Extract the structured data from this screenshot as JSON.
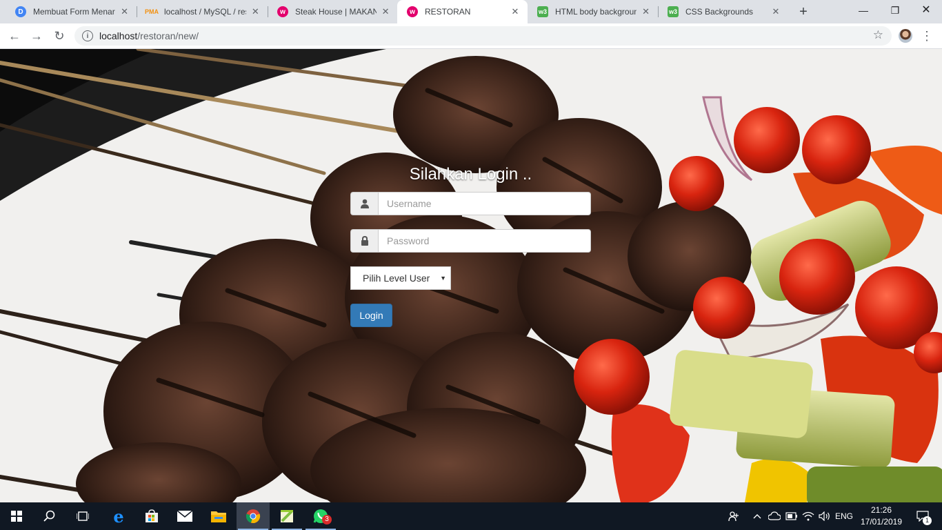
{
  "browser": {
    "tabs": [
      {
        "title": "Membuat Form Menarik",
        "favicon": "letter-d-icon",
        "favicon_color": "#4285f4",
        "active": false
      },
      {
        "title": "localhost / MySQL / res",
        "favicon": "phpmyadmin-icon",
        "favicon_color": "#f29111",
        "active": false
      },
      {
        "title": "Steak House | MAKANAN",
        "favicon": "w-shield-icon",
        "favicon_color": "#e3006d",
        "active": false
      },
      {
        "title": "RESTORAN",
        "favicon": "w-shield-icon",
        "favicon_color": "#e3006d",
        "active": true
      },
      {
        "title": "HTML body background",
        "favicon": "w3schools-icon",
        "favicon_color": "#4caf50",
        "active": false
      },
      {
        "title": "CSS Backgrounds",
        "favicon": "w3schools-icon",
        "favicon_color": "#4caf50",
        "active": false
      }
    ],
    "address": {
      "host": "localhost",
      "path": "/restoran/new/"
    }
  },
  "page": {
    "heading": "Silahkan Login ..",
    "username_placeholder": "Username",
    "password_placeholder": "Password",
    "level_select": {
      "selected": "Pilih Level User"
    },
    "login_button": "Login",
    "accent_color": "#337ab7"
  },
  "taskbar": {
    "apps": [
      "start-icon",
      "search-icon",
      "task-view-icon",
      "edge-icon",
      "store-icon",
      "mail-icon",
      "file-explorer-icon",
      "chrome-icon",
      "notepad-plus-icon",
      "whatsapp-icon"
    ],
    "whatsapp_badge": "3",
    "language": "ENG",
    "time": "21:26",
    "date": "17/01/2019",
    "notification_count": "1"
  }
}
